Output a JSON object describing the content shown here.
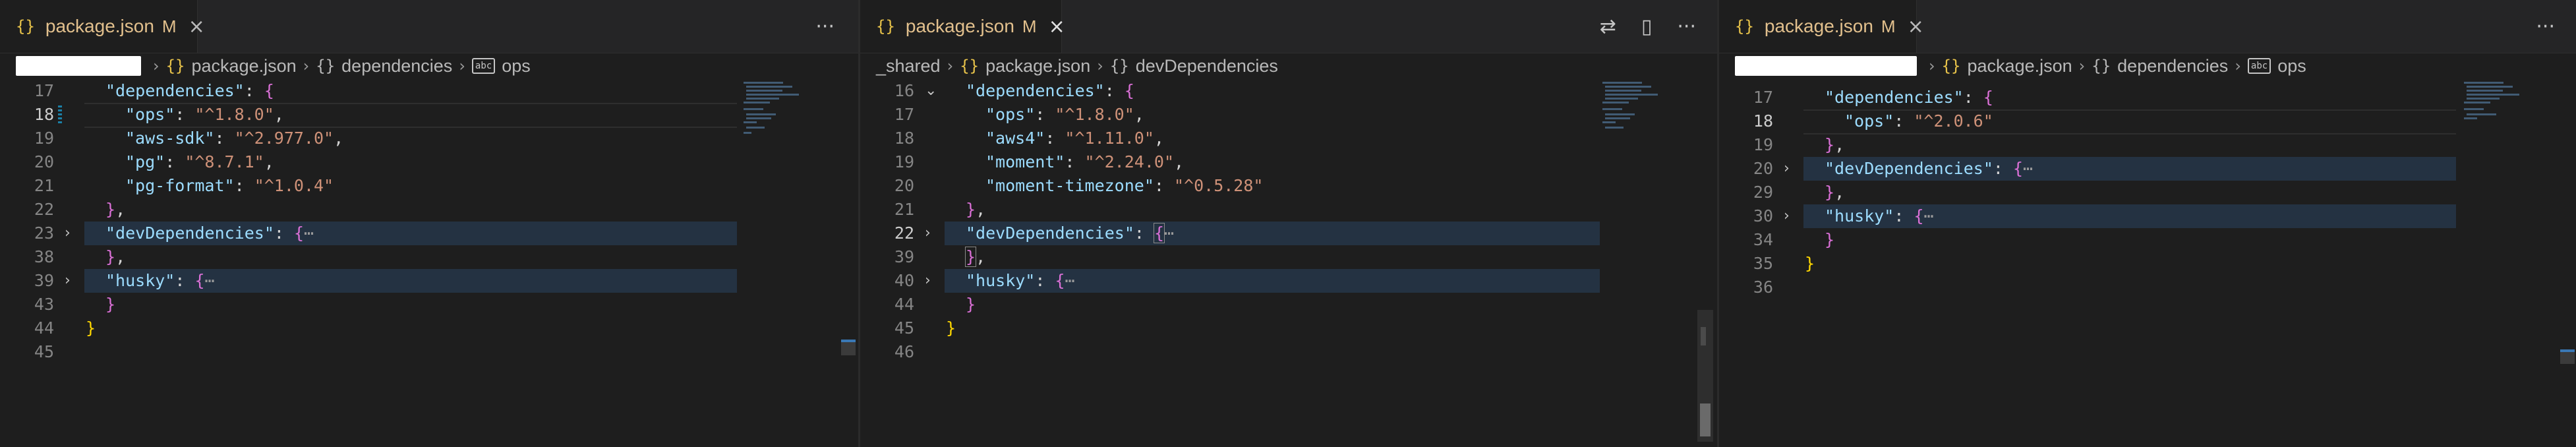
{
  "panes": [
    {
      "tab": {
        "icon": "{}",
        "name": "package.json",
        "modified": "M",
        "close": "×"
      },
      "actions": [
        "···"
      ],
      "breadcrumb": {
        "segments": [
          "package.json",
          "dependencies",
          "ops"
        ]
      },
      "lines": [
        {
          "n": "17",
          "text": "\"dependencies\": {"
        },
        {
          "n": "18",
          "text": "\"ops\": \"^1.8.0\","
        },
        {
          "n": "19",
          "text": "\"aws-sdk\": \"^2.977.0\","
        },
        {
          "n": "20",
          "text": "\"pg\": \"^8.7.1\","
        },
        {
          "n": "21",
          "text": "\"pg-format\": \"^1.0.4\""
        },
        {
          "n": "22",
          "text": "},"
        },
        {
          "n": "23",
          "text": "\"devDependencies\": {⋯"
        },
        {
          "n": "38",
          "text": "},"
        },
        {
          "n": "39",
          "text": "\"husky\": {⋯"
        },
        {
          "n": "43",
          "text": "}"
        },
        {
          "n": "44",
          "text": "}"
        },
        {
          "n": "45",
          "text": ""
        }
      ]
    },
    {
      "tab": {
        "icon": "{}",
        "name": "package.json",
        "modified": "M",
        "close": "×"
      },
      "actions": [
        "⇄",
        "▯",
        "···"
      ],
      "breadcrumb": {
        "segments": [
          "_shared",
          "package.json",
          "devDependencies"
        ]
      },
      "lines": [
        {
          "n": "16",
          "text": "\"dependencies\": {"
        },
        {
          "n": "17",
          "text": "\"ops\": \"^1.8.0\","
        },
        {
          "n": "18",
          "text": "\"aws4\": \"^1.11.0\","
        },
        {
          "n": "19",
          "text": "\"moment\": \"^2.24.0\","
        },
        {
          "n": "20",
          "text": "\"moment-timezone\": \"^0.5.28\""
        },
        {
          "n": "21",
          "text": "},"
        },
        {
          "n": "22",
          "text": "\"devDependencies\": {⋯"
        },
        {
          "n": "39",
          "text": "},"
        },
        {
          "n": "40",
          "text": "\"husky\": {⋯"
        },
        {
          "n": "44",
          "text": "}"
        },
        {
          "n": "45",
          "text": "}"
        },
        {
          "n": "46",
          "text": ""
        }
      ]
    },
    {
      "tab": {
        "icon": "{}",
        "name": "package.json",
        "modified": "M",
        "close": "×"
      },
      "actions": [
        "···"
      ],
      "breadcrumb": {
        "segments": [
          "package.json",
          "dependencies",
          "ops"
        ]
      },
      "lines": [
        {
          "n": "17",
          "text": "\"dependencies\": {"
        },
        {
          "n": "18",
          "text": "\"ops\": \"^2.0.6\""
        },
        {
          "n": "19",
          "text": "},"
        },
        {
          "n": "20",
          "text": "\"devDependencies\": {⋯"
        },
        {
          "n": "29",
          "text": "},"
        },
        {
          "n": "30",
          "text": "\"husky\": {⋯"
        },
        {
          "n": "34",
          "text": "}"
        },
        {
          "n": "35",
          "text": "}"
        },
        {
          "n": "36",
          "text": ""
        }
      ]
    }
  ],
  "fold_icon": "›",
  "colors": {
    "key": "#9cdcfe",
    "string": "#ce9178",
    "bracket_gold": "#ffd700",
    "bracket_purple": "#da70d6",
    "tab_modified": "#e2c08d",
    "fold_highlight": "#243242"
  }
}
